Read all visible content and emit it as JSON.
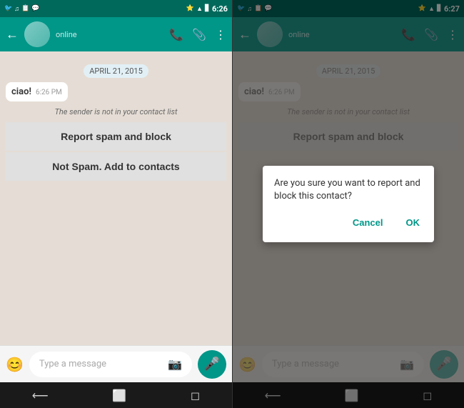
{
  "screen1": {
    "status_bar": {
      "time": "6:26",
      "icons_left": [
        "twitter-icon",
        "music-icon",
        "screenshot-icon",
        "hangouts-icon",
        "signal-icon"
      ],
      "icons_right": [
        "bluetooth-icon",
        "wifi-icon",
        "signal-bars-icon",
        "battery-icon"
      ]
    },
    "toolbar": {
      "back_label": "←",
      "contact_name": "",
      "contact_status": "online",
      "phone_icon": "📞",
      "attachment_icon": "📎",
      "more_icon": "⋮"
    },
    "date_divider": "APRIL 21, 2015",
    "message": {
      "text": "ciao!",
      "time": "6:26 PM"
    },
    "spam_notice": "The sender is not in your contact list",
    "report_btn": "Report spam and block",
    "not_spam_btn": "Not Spam. Add to contacts",
    "input": {
      "placeholder": "Type a message",
      "emoji": "😊",
      "camera": "📷",
      "mic": "🎤"
    }
  },
  "screen2": {
    "status_bar": {
      "time": "6:27"
    },
    "toolbar": {
      "contact_status": "online"
    },
    "date_divider": "APRIL 21, 2015",
    "message": {
      "text": "ciao!",
      "time": "6:26 PM"
    },
    "spam_notice": "The sender is not in your contact list",
    "report_btn": "Report spam and block",
    "dialog": {
      "text": "Are you sure you want to report and block this contact?",
      "cancel_label": "Cancel",
      "ok_label": "OK"
    },
    "input": {
      "placeholder": "Type a message",
      "emoji": "😊",
      "camera": "📷",
      "mic": "🎤"
    }
  },
  "nav": {
    "back": "⟵",
    "home": "⬜",
    "recent": "◻"
  }
}
